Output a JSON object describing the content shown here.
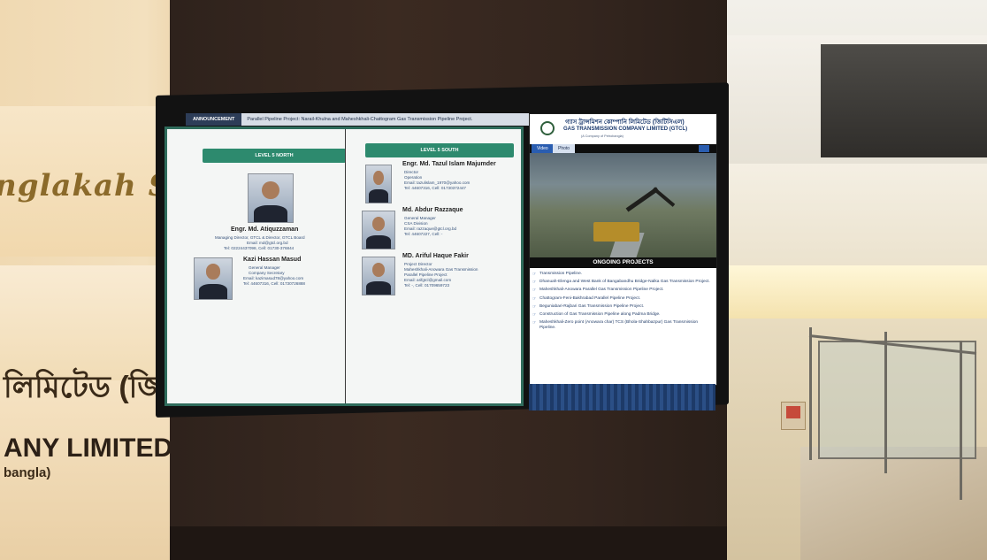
{
  "environment": {
    "script_logo": "nglakah Sinc",
    "bangla_name": "লিমিটেড (জিটি",
    "company_en": "ANY LIMITED (GT",
    "company_sub": "bangla)"
  },
  "ticker": {
    "label": "ANNOUNCEMENT",
    "text": "Parallel Pipeline Project: Narail-Khulna and Maheshkhali-Chattogram Gas Transmission Pipeline Project."
  },
  "left_screen": {
    "north": {
      "title": "LEVEL 5 NORTH",
      "people": [
        {
          "name": "Engr. Md. Atiquzzaman",
          "lines": [
            "Managing Director, GTCL & Director, GTCL Board",
            "Email: md@gtcl.org.bd",
            "Tel: 02224437098, Cell: 01730-376844"
          ]
        },
        {
          "name": "Kazi Hassan Masud",
          "lines": [
            "General Manager",
            "Company Secretary",
            "Email: kazimasud78@yahoo.com",
            "Tel: 44607316, Cell: 01730726888"
          ]
        }
      ]
    },
    "south": {
      "title": "LEVEL 5 SOUTH",
      "people": [
        {
          "name": "Engr. Md. Tazul Islam Majumder",
          "lines": [
            "Director",
            "Operation",
            "Email: tazulislam_1970@yahoo.com",
            "Tel: 44607316, Cell: 01730372447"
          ]
        },
        {
          "name": "Md. Abdur Razzaque",
          "lines": [
            "General Manager",
            "CSA Division",
            "Email: razzaque@gtcl.org.bd",
            "Tel: 44607227, Cell: -"
          ]
        },
        {
          "name": "MD. Ariful Haque Fakir",
          "lines": [
            "Project Director",
            "Maheshkhali-Anowara Gas Transmission",
            "Parallel Pipeline Project",
            "Email: arifgtcl@gmail.com",
            "Tel: -, Cell: 01709659723"
          ]
        }
      ]
    }
  },
  "right_screen": {
    "header_bn": "গ্যাস ট্রান্সমিশন কোম্পানি লিমিটেড (জিটিসিএল)",
    "header_en": "GAS TRANSMISSION COMPANY LIMITED (GTCL)",
    "header_sub": "(A Company of Petrobangla)",
    "tabs": {
      "video": "Video",
      "photo": "Photo"
    },
    "section_title": "ONGOING PROJECTS",
    "projects": [
      "Transmission Pipeline.",
      "Dhanuah-Elenga and West Bank of Bangabandhu Bridge-Nalka Gas Transmission Project.",
      "Maheshkhali-Anowara Parallel Gas Transmission Pipeline Project.",
      "Chattogram-Feni-Bakhrabad Parallel Pipeline Project.",
      "Beguniabari-Rajbari Gas Transmission Pipeline Project.",
      "Construction of Gas Transmission Pipeline along Padma Bridge.",
      "Maheshkhali-Zero point (Anowara char) TCS (Bhola-Shahbazpur) Gas Transmission Pipeline."
    ]
  },
  "colors": {
    "level_header": "#2d8a6e",
    "screen_border": "#2f6c5c",
    "link_text": "#35517a"
  }
}
